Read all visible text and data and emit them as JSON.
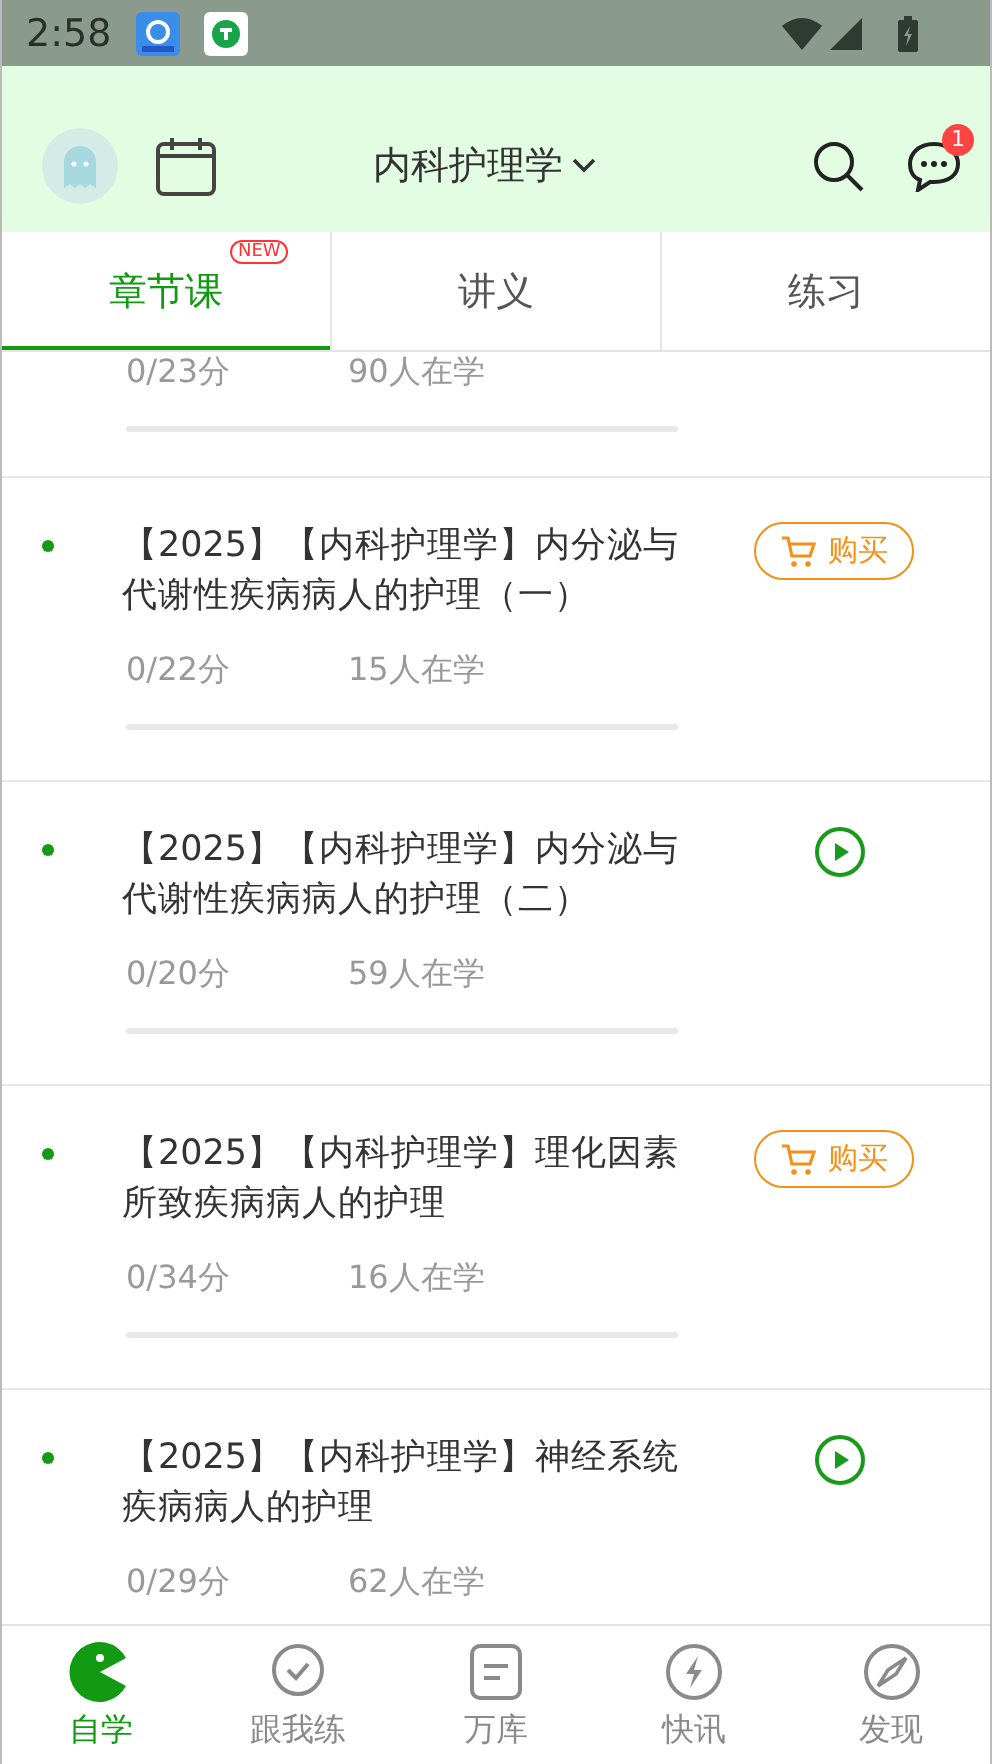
{
  "status_bar": {
    "time": "2:58"
  },
  "header": {
    "title": "内科护理学",
    "message_badge": "1"
  },
  "tabs": [
    {
      "label": "章节课",
      "selected": true,
      "badge": "NEW"
    },
    {
      "label": "讲义",
      "selected": false
    },
    {
      "label": "练习",
      "selected": false
    }
  ],
  "lessons": [
    {
      "score": "0/23分",
      "learners": "90人在学"
    },
    {
      "title": "【2025】【内科护理学】内分泌与代谢性疾病病人的护理（一）",
      "action": {
        "kind": "buy",
        "label": "购买"
      },
      "score": "0/22分",
      "learners": "15人在学"
    },
    {
      "title": "【2025】【内科护理学】内分泌与代谢性疾病病人的护理（二）",
      "action": {
        "kind": "play"
      },
      "score": "0/20分",
      "learners": "59人在学"
    },
    {
      "title": "【2025】【内科护理学】理化因素所致疾病病人的护理",
      "action": {
        "kind": "buy",
        "label": "购买"
      },
      "score": "0/34分",
      "learners": "16人在学"
    },
    {
      "title": "【2025】【内科护理学】神经系统疾病病人的护理",
      "action": {
        "kind": "play"
      },
      "score": "0/29分",
      "learners": "62人在学"
    }
  ],
  "bottom_nav": [
    {
      "label": "自学",
      "selected": true
    },
    {
      "label": "跟我练",
      "selected": false
    },
    {
      "label": "万库",
      "selected": false
    },
    {
      "label": "快讯",
      "selected": false
    },
    {
      "label": "发现",
      "selected": false
    }
  ]
}
